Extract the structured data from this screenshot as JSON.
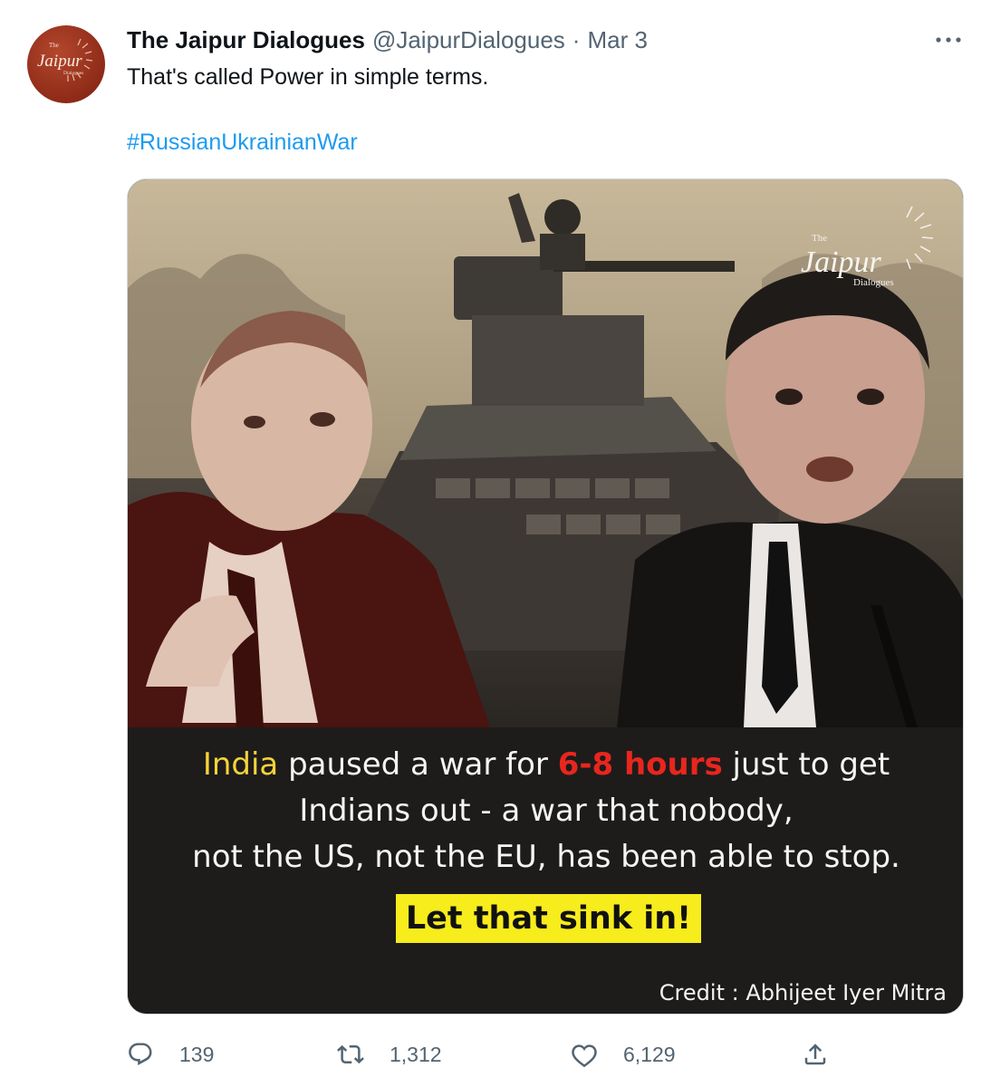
{
  "tweet": {
    "display_name": "The Jaipur Dialogues",
    "handle": "@JaipurDialogues",
    "separator": "·",
    "date": "Mar 3",
    "text": "That's called Power in simple terms.",
    "hashtag": "#RussianUkrainianWar"
  },
  "avatar": {
    "logo_the": "The",
    "logo_main": "Jaipur",
    "logo_sub": "Dialogues",
    "background_color": "#8e2b18"
  },
  "media": {
    "logo_the": "The",
    "logo_main": "Jaipur",
    "logo_sub": "Dialogues",
    "caption": {
      "line1_yellow": "India",
      "line1_a": " paused a war for ",
      "line1_red": "6-8 hours",
      "line1_b": " just to get",
      "line2": "Indians out - a war that nobody,",
      "line3": "not the US, not the EU, has been able to stop."
    },
    "highlight": "Let that sink in!",
    "credit": "Credit : Abhijeet Iyer Mitra",
    "colors": {
      "yellow_text": "#f5d33a",
      "red_text": "#e8261e",
      "highlight_bg": "#f7ec1c",
      "panel_bg": "#1d1c1b"
    }
  },
  "actions": {
    "reply": {
      "icon": "reply-icon",
      "count": "139"
    },
    "retweet": {
      "icon": "retweet-icon",
      "count": "1,312"
    },
    "like": {
      "icon": "heart-icon",
      "count": "6,129"
    },
    "share": {
      "icon": "share-icon"
    }
  },
  "colors": {
    "text_primary": "#0f1419",
    "text_secondary": "#536471",
    "link": "#1d9bf0"
  }
}
